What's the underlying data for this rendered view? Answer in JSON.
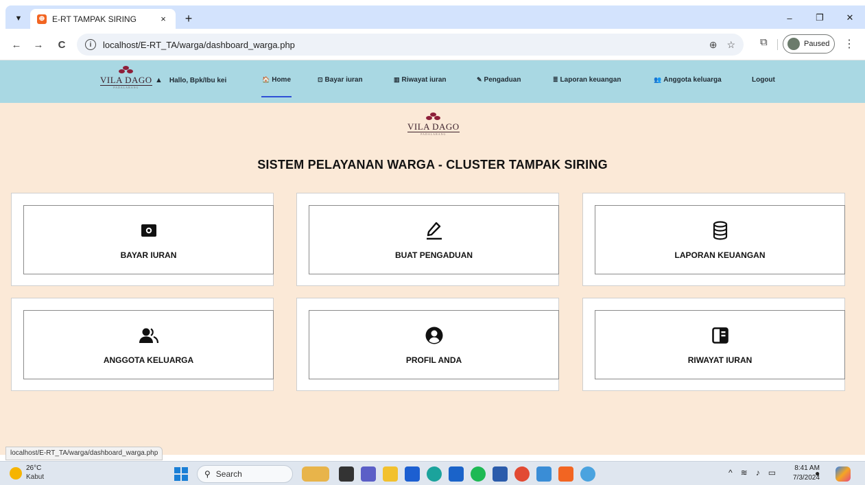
{
  "browser": {
    "tab_title": "E-RT TAMPAK SIRING",
    "tab_close": "×",
    "new_tab": "+",
    "url": "localhost/E-RT_TA/warga/dashboard_warga.php",
    "profile_status": "Paused",
    "controls": {
      "minimize": "–",
      "restore": "❐",
      "close": "✕"
    },
    "nav": {
      "back": "←",
      "forward": "→",
      "reload": "C"
    }
  },
  "navbar": {
    "logo_text": "VILA DAGO",
    "logo_sub": "PADALARANG",
    "user_greeting": "Hallo, Bpk/Ibu kei",
    "items": [
      {
        "label": "Home",
        "icon": "🏠"
      },
      {
        "label": "Bayar iuran",
        "icon": "⊡"
      },
      {
        "label": "Riwayat iuran",
        "icon": "▥"
      },
      {
        "label": "Pengaduan",
        "icon": "✎"
      },
      {
        "label": "Laporan keuangan",
        "icon": "≣"
      },
      {
        "label": "Anggota keluarga",
        "icon": "👥"
      },
      {
        "label": "Logout",
        "icon": ""
      }
    ]
  },
  "page": {
    "title": "SISTEM PELAYANAN WARGA - CLUSTER TAMPAK SIRING",
    "cards": [
      {
        "label": "BAYAR IURAN",
        "icon": "cash-icon"
      },
      {
        "label": "BUAT PENGADUAN",
        "icon": "pencil-icon"
      },
      {
        "label": "LAPORAN KEUANGAN",
        "icon": "database-icon"
      },
      {
        "label": "ANGGOTA KELUARGA",
        "icon": "people-icon"
      },
      {
        "label": "PROFIL ANDA",
        "icon": "profile-icon"
      },
      {
        "label": "RIWAYAT IURAN",
        "icon": "journal-icon"
      }
    ]
  },
  "status_bar_url": "localhost/E-RT_TA/warga/dashboard_warga.php",
  "taskbar": {
    "weather_temp": "26°C",
    "weather_desc": "Kabut",
    "search_placeholder": "Search",
    "time": "8:41 AM",
    "date": "7/3/2024"
  }
}
